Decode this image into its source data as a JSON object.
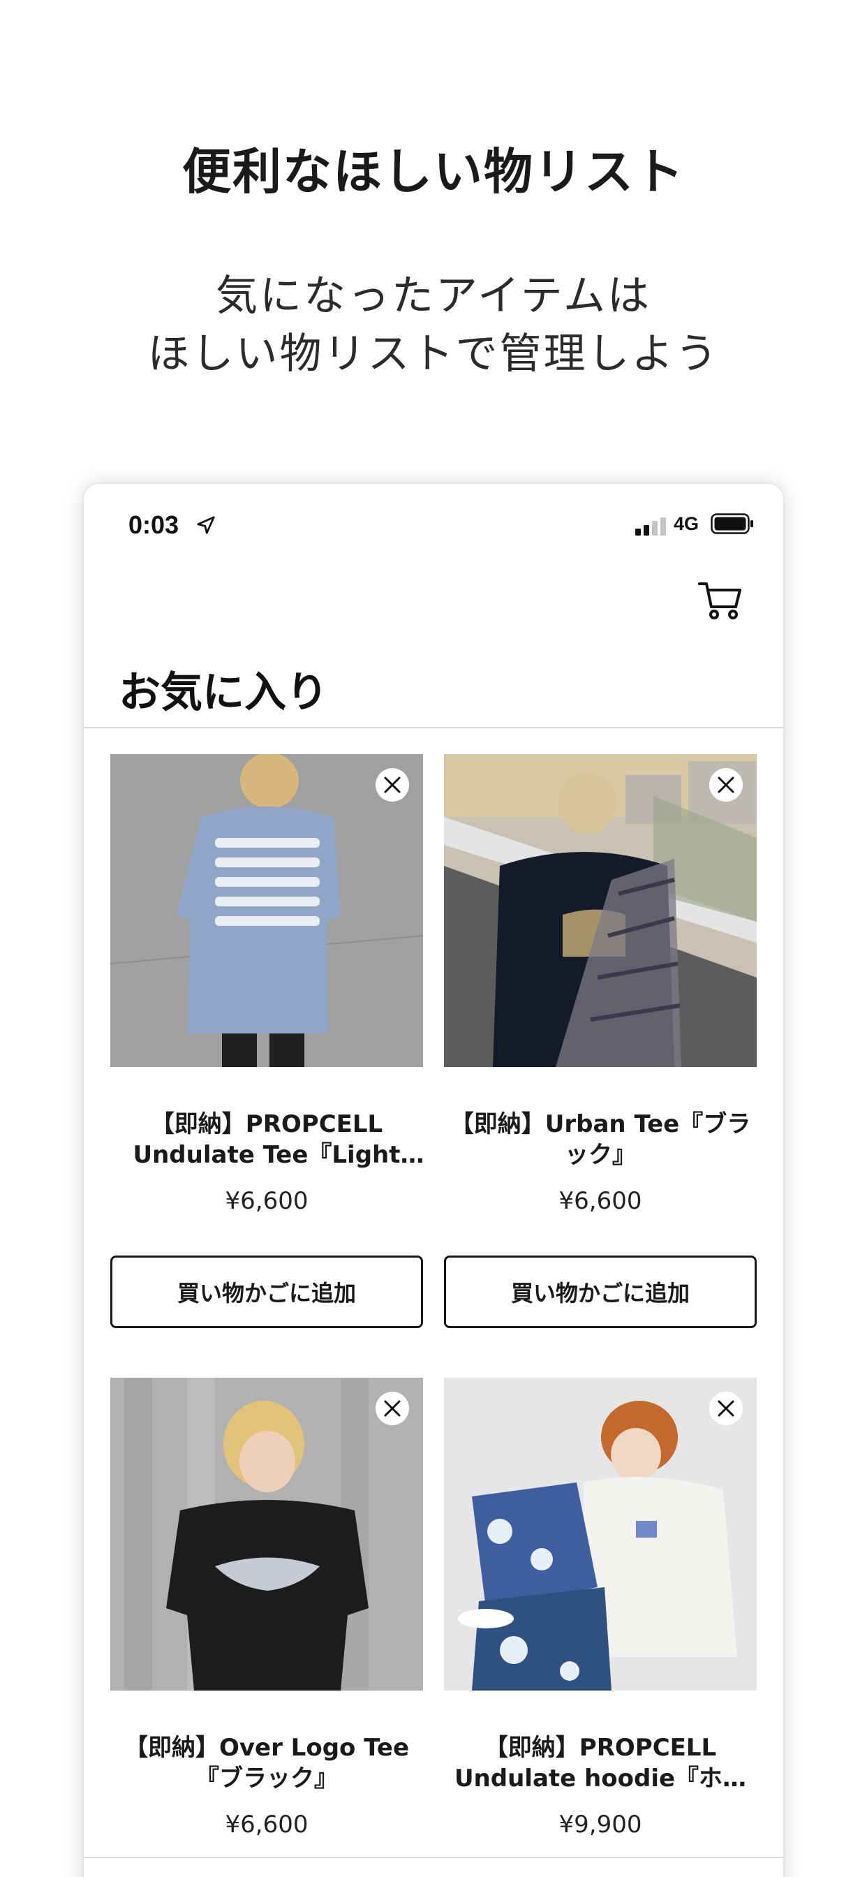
{
  "promo": {
    "title": "便利なほしい物リスト",
    "subtitle_line1": "気になったアイテムは",
    "subtitle_line2": "ほしい物リストで管理しよう"
  },
  "status_bar": {
    "time": "0:03",
    "network": "4G"
  },
  "page": {
    "title": "お気に入り"
  },
  "products": [
    {
      "name": "【即納】PROPCELL Undulate Tee『Light Blue』",
      "price": "¥6,600",
      "button": "買い物かごに追加"
    },
    {
      "name": "【即納】Urban Tee『ブラック』",
      "price": "¥6,600",
      "button": "買い物かごに追加"
    },
    {
      "name": "【即納】Over Logo Tee『ブラック』",
      "price": "¥6,600"
    },
    {
      "name": "【即納】PROPCELL Undulate hoodie『ホワイト』",
      "price": "¥9,900"
    }
  ],
  "colors": {
    "accent": "#1a1a1a",
    "divider": "#d9d9d9"
  }
}
